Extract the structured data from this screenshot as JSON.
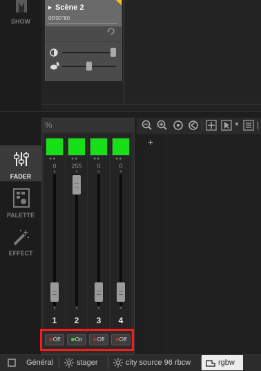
{
  "sidebar": {
    "show_label": "SHOW",
    "fader_label": "FADER",
    "palette_label": "PALETTE",
    "effect_label": "EFFECT"
  },
  "scene": {
    "title": "Scène 2",
    "time": "00'00\"80"
  },
  "fader": {
    "percent_label": "%",
    "channels": [
      {
        "number": "1",
        "value": "0",
        "level": 0,
        "toggle": "Off",
        "on": false
      },
      {
        "number": "2",
        "value": "255",
        "level": 1,
        "toggle": "On",
        "on": true
      },
      {
        "number": "3",
        "value": "0",
        "level": 0,
        "toggle": "Off",
        "on": false
      },
      {
        "number": "4",
        "value": "0",
        "level": 0,
        "toggle": "Off",
        "on": false
      }
    ]
  },
  "canvas": {
    "add_symbol": "+"
  },
  "tabs": [
    {
      "label": "Général",
      "icon": "blank-tab-icon",
      "active": false
    },
    {
      "label": "stager",
      "icon": "light-icon",
      "active": false
    },
    {
      "label": "city source 96 rbcw",
      "icon": "light-icon",
      "active": false
    },
    {
      "label": "rgbw",
      "icon": "fixture-icon",
      "active": true
    }
  ],
  "colors": {
    "swatch_green": "#18e018",
    "highlight_red": "#ff1a1a"
  }
}
